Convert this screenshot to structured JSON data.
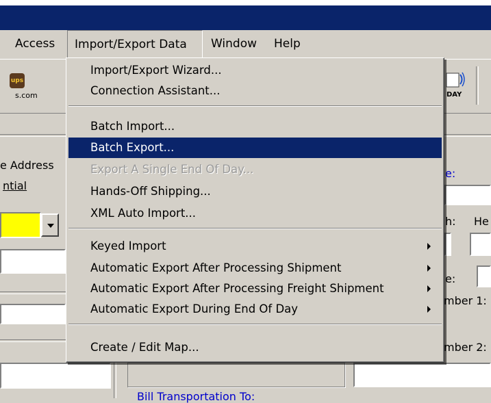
{
  "menubar": {
    "items": [
      {
        "label": "Access"
      },
      {
        "label": "Import/Export Data"
      },
      {
        "label": "Window"
      },
      {
        "label": "Help"
      }
    ]
  },
  "toolbar": {
    "ups_logo_text": "ups",
    "ups_caption": "s.com",
    "eod_caption": "DAY"
  },
  "left_panel": {
    "address_label": "e Address",
    "residential_label": "ntial"
  },
  "right_panel": {
    "label_e": "e:",
    "label_h": "h:",
    "label_he": "He",
    "label_e2": "e:",
    "number1_label": "mber 1:",
    "number2_label": "mber 2:",
    "bill_transportation_label": "Bill Transportation To:"
  },
  "dropdown": {
    "items": [
      {
        "label": "Import/Export Wizard...",
        "enabled": true
      },
      {
        "label": "Connection Assistant...",
        "enabled": true
      },
      {
        "label": "Batch Import...",
        "enabled": true
      },
      {
        "label": "Batch Export...",
        "enabled": true,
        "highlighted": true
      },
      {
        "label": "Export A Single End Of Day...",
        "enabled": false
      },
      {
        "label": "Hands-Off Shipping...",
        "enabled": true
      },
      {
        "label": "XML Auto Import...",
        "enabled": true
      },
      {
        "label": "Keyed Import",
        "enabled": true,
        "submenu": true
      },
      {
        "label": "Automatic Export After Processing Shipment",
        "enabled": true,
        "submenu": true
      },
      {
        "label": "Automatic Export After Processing Freight Shipment",
        "enabled": true,
        "submenu": true
      },
      {
        "label": "Automatic Export During End Of Day",
        "enabled": true,
        "submenu": true
      },
      {
        "label": "Create / Edit Map...",
        "enabled": true
      }
    ]
  },
  "colors": {
    "titlebar": "#0a246a",
    "highlight": "#0a246a",
    "face": "#d4d0c8",
    "yellow_field": "#ffff00"
  }
}
